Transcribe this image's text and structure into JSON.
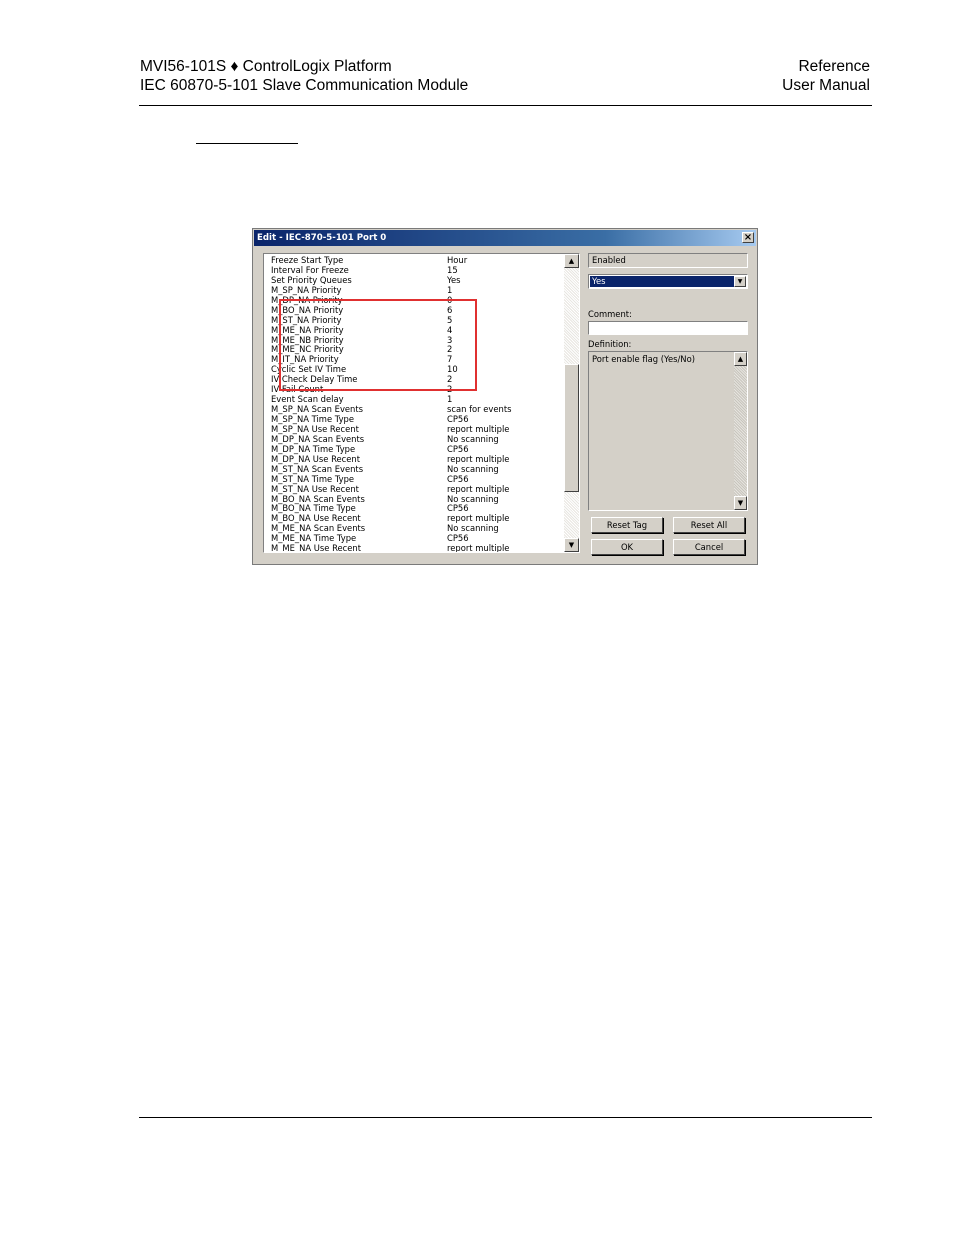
{
  "header": {
    "left_line1": "MVI56-101S ♦ ControlLogix Platform",
    "left_line2": "IEC 60870-5-101 Slave Communication Module",
    "right_line1": "Reference",
    "right_line2": "User Manual"
  },
  "dialog": {
    "title": "Edit - IEC-870-5-101 Port 0",
    "close_glyph": "×",
    "rows": [
      {
        "name": "Freeze Start Type",
        "value": "Hour"
      },
      {
        "name": "Interval For Freeze",
        "value": "15"
      },
      {
        "name": "Set Priority Queues",
        "value": "Yes"
      },
      {
        "name": "M_SP_NA Priority",
        "value": "1"
      },
      {
        "name": "M_DP_NA Priority",
        "value": "0"
      },
      {
        "name": "M_BO_NA Priority",
        "value": "6"
      },
      {
        "name": "M_ST_NA Priority",
        "value": "5"
      },
      {
        "name": "M_ME_NA Priority",
        "value": "4"
      },
      {
        "name": "M_ME_NB Priority",
        "value": "3"
      },
      {
        "name": "M_ME_NC Priority",
        "value": "2"
      },
      {
        "name": "M_IT_NA Priority",
        "value": "7"
      },
      {
        "name": "Cyclic Set IV Time",
        "value": "10"
      },
      {
        "name": "IV Check Delay Time",
        "value": "2"
      },
      {
        "name": "IV Fail Count",
        "value": "2"
      },
      {
        "name": "Event Scan delay",
        "value": "1"
      },
      {
        "name": "M_SP_NA Scan Events",
        "value": "scan for events"
      },
      {
        "name": "M_SP_NA Time Type",
        "value": "CP56"
      },
      {
        "name": "M_SP_NA Use Recent",
        "value": "report multiple"
      },
      {
        "name": "M_DP_NA Scan Events",
        "value": "No scanning"
      },
      {
        "name": "M_DP_NA Time Type",
        "value": "CP56"
      },
      {
        "name": "M_DP_NA Use Recent",
        "value": "report multiple"
      },
      {
        "name": "M_ST_NA Scan Events",
        "value": "No scanning"
      },
      {
        "name": "M_ST_NA Time Type",
        "value": "CP56"
      },
      {
        "name": "M_ST_NA Use Recent",
        "value": "report multiple"
      },
      {
        "name": "M_BO_NA Scan Events",
        "value": "No scanning"
      },
      {
        "name": "M_BO_NA Time Type",
        "value": "CP56"
      },
      {
        "name": "M_BO_NA Use Recent",
        "value": "report multiple"
      },
      {
        "name": "M_ME_NA Scan Events",
        "value": "No scanning"
      },
      {
        "name": "M_ME_NA Time Type",
        "value": "CP56"
      },
      {
        "name": "M_ME_NA Use Recent",
        "value": "report multiple"
      }
    ],
    "scroll_up_glyph": "▲",
    "scroll_down_glyph": "▼",
    "enabled_label": "Enabled",
    "selected_value": "Yes",
    "dropdown_glyph": "▼",
    "comment_label": "Comment:",
    "comment_value": "",
    "definition_label": "Definition:",
    "definition_text": "Port enable flag (Yes/No)",
    "buttons": {
      "reset_tag": "Reset Tag",
      "reset_all": "Reset All",
      "ok": "OK",
      "cancel": "Cancel"
    },
    "highlight_color": "#e03030",
    "title_color": "#0a246a"
  }
}
